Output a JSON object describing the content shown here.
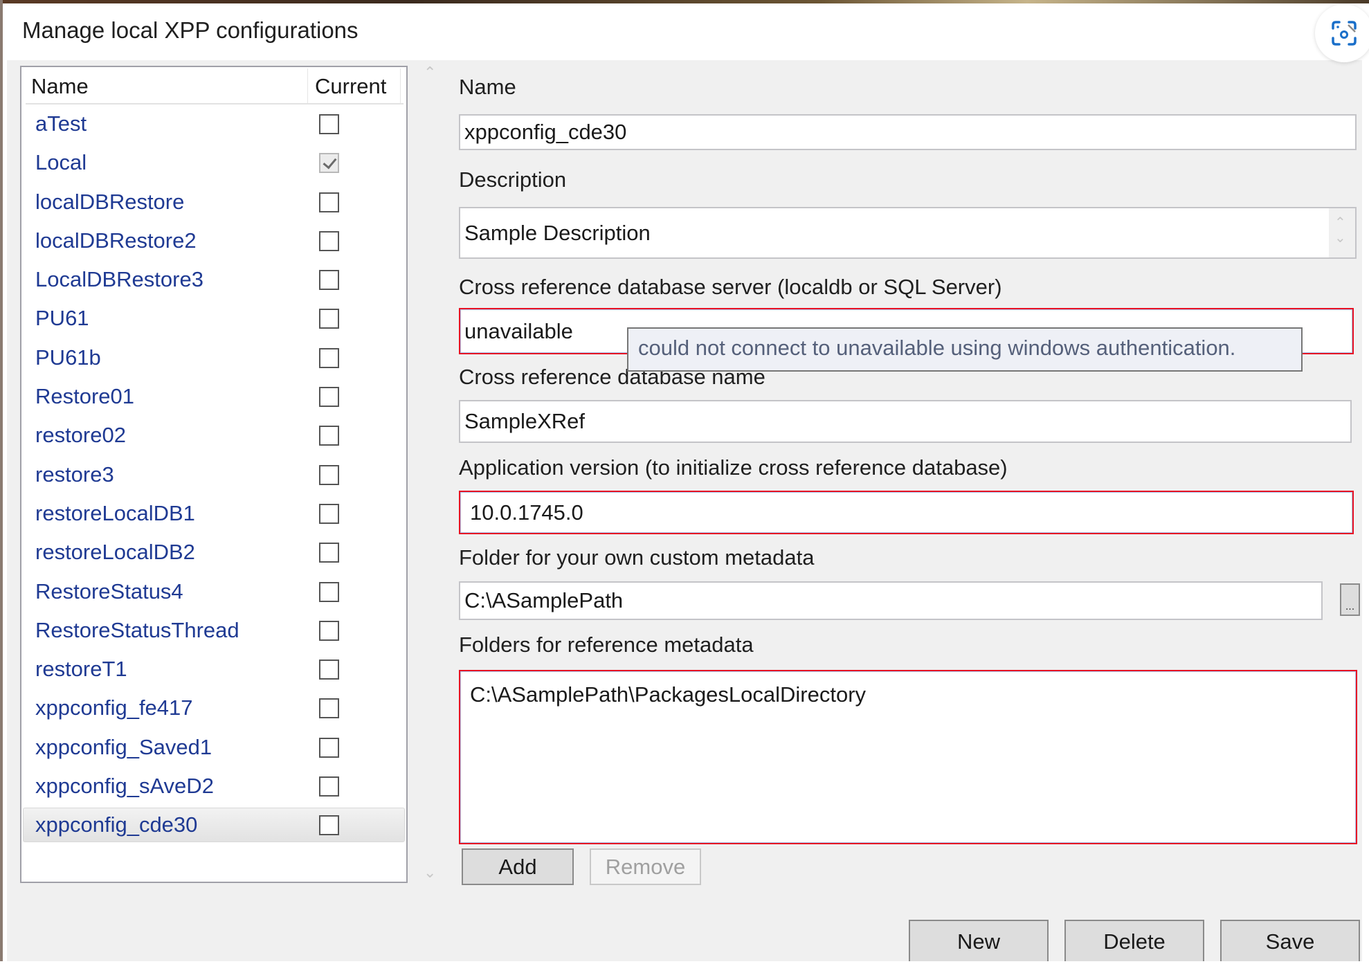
{
  "window": {
    "title": "Manage local XPP configurations"
  },
  "overlay": {
    "capture_icon": "screen-capture-icon"
  },
  "list": {
    "columns": {
      "name": "Name",
      "current": "Current"
    },
    "rows": [
      {
        "name": "aTest",
        "current": false
      },
      {
        "name": "Local",
        "current": true
      },
      {
        "name": "localDBRestore",
        "current": false
      },
      {
        "name": "localDBRestore2",
        "current": false
      },
      {
        "name": "LocalDBRestore3",
        "current": false
      },
      {
        "name": "PU61",
        "current": false
      },
      {
        "name": "PU61b",
        "current": false
      },
      {
        "name": "Restore01",
        "current": false
      },
      {
        "name": "restore02",
        "current": false
      },
      {
        "name": "restore3",
        "current": false
      },
      {
        "name": "restoreLocalDB1",
        "current": false
      },
      {
        "name": "restoreLocalDB2",
        "current": false
      },
      {
        "name": "RestoreStatus4",
        "current": false
      },
      {
        "name": "RestoreStatusThread",
        "current": false
      },
      {
        "name": "restoreT1",
        "current": false
      },
      {
        "name": "xppconfig_fe417",
        "current": false
      },
      {
        "name": "xppconfig_Saved1",
        "current": false
      },
      {
        "name": "xppconfig_sAveD2",
        "current": false
      },
      {
        "name": "xppconfig_cde30",
        "current": false
      }
    ],
    "selected_index": 18
  },
  "form": {
    "name_label": "Name",
    "name_value": "xppconfig_cde30",
    "description_label": "Description",
    "description_value": "Sample Description",
    "server_label": "Cross reference database server (localdb or SQL Server)",
    "server_value": "unavailable",
    "server_error_tooltip": "could not connect to unavailable using windows authentication.",
    "dbname_label": "Cross reference database name",
    "dbname_value": "SampleXRef",
    "appversion_label": "Application version (to initialize cross reference database)",
    "appversion_value": "10.0.1745.0",
    "custom_folder_label": "Folder for your own custom metadata",
    "custom_folder_value": "C:\\ASamplePath",
    "browse_label": "...",
    "ref_folders_label": "Folders for reference metadata",
    "ref_folders": [
      "C:\\ASamplePath\\PackagesLocalDirectory"
    ],
    "add_label": "Add",
    "remove_label": "Remove"
  },
  "actions": {
    "new_label": "New",
    "delete_label": "Delete",
    "save_label": "Save"
  },
  "colors": {
    "error_border": "#e81123",
    "list_text": "#1f3a93",
    "tooltip_bg": "#eef0f6"
  }
}
